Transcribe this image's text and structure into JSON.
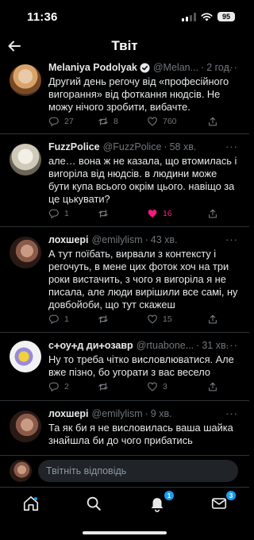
{
  "status_bar": {
    "time": "11:36",
    "battery": "95"
  },
  "header": {
    "title": "Твіт"
  },
  "tweets": [
    {
      "name": "Melaniya Podolyak",
      "handle": "@Melan...",
      "time": "2 год.",
      "verified": true,
      "text": "Другий день регочу від «професійного вигорання» від фоткання нюдсів. Не можу нічого зробити, вибачте.",
      "replies": "27",
      "retweets": "8",
      "likes": "760",
      "liked": false
    },
    {
      "name": "FuzzPolice",
      "handle": "@FuzzPolice",
      "time": "58 хв.",
      "verified": false,
      "text": "але… вона ж не казала, що втомилась і вигоріла від нюдсів. в людини може бути купа всього окрім цього. навіщо за це цькувати?",
      "replies": "1",
      "retweets": "",
      "likes": "16",
      "liked": true
    },
    {
      "name": "лохшері",
      "handle": "@emilylism",
      "time": "43 хв.",
      "verified": false,
      "text": "А тут поїбать, вирвали з контексту і регочуть, в мене цих фоток хоч на три роки вистачить, з чого я вигоріла я не писала, але люди вирішили все самі, ну довбойоби, що тут скажеш",
      "replies": "1",
      "retweets": "",
      "likes": "15",
      "liked": false
    },
    {
      "name": "с🕂оу🕂д ди🕂озавр",
      "handle": "@rtuabone...",
      "time": "31 хв.",
      "verified": false,
      "text": "Ну то треба чітко висловлюватися. Але вже пізно, бо угорати з вас весело",
      "replies": "2",
      "retweets": "",
      "likes": "3",
      "liked": false
    },
    {
      "name": "лохшері",
      "handle": "@emilylism",
      "time": "9 хв.",
      "verified": false,
      "text": "Та як би я не висловилась ваша шайка знайшла би до чого прибатись",
      "replies": "",
      "retweets": "",
      "likes": "",
      "liked": false
    }
  ],
  "reply_bar": {
    "placeholder": "Твітніть відповідь"
  },
  "bottom_nav": {
    "notifications_badge": "1",
    "messages_badge": "3"
  },
  "colors": {
    "accent": "#1d9bf0",
    "like": "#f91880",
    "muted": "#71767b",
    "background": "#000000"
  }
}
